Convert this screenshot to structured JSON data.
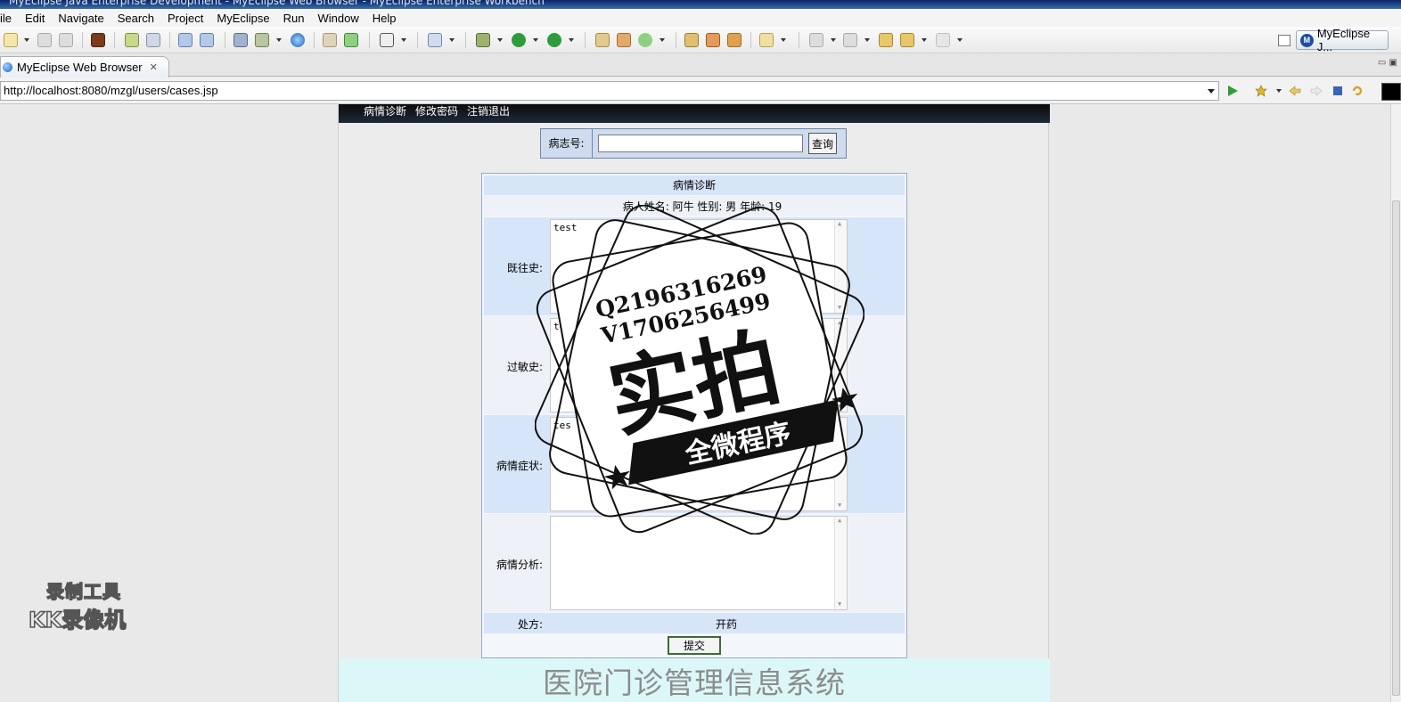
{
  "window": {
    "title": "MyEclipse Java Enterprise Development - MyEclipse Web Browser - MyEclipse Enterprise Workbench"
  },
  "menu": [
    "ile",
    "Edit",
    "Navigate",
    "Search",
    "Project",
    "MyEclipse",
    "Run",
    "Window",
    "Help"
  ],
  "toolbar": {
    "perspective_label": "MyEclipse J..."
  },
  "editor_tab": {
    "label": "MyEclipse Web Browser"
  },
  "browser": {
    "url": "http://localhost:8080/mzgl/users/cases.jsp"
  },
  "page": {
    "nav": [
      "病情诊断",
      "修改密码",
      "注销退出"
    ],
    "search": {
      "label": "病志号:",
      "value": "",
      "button": "查询"
    },
    "form": {
      "title": "病情诊断",
      "patient_info": "病人姓名: 阿牛 性别: 男 年龄: 19",
      "fields": [
        {
          "label": "既往史:",
          "value": "test"
        },
        {
          "label": "过敏史:",
          "value": "test"
        },
        {
          "label": "病情症状:",
          "value": "tes"
        },
        {
          "label": "病情分析:",
          "value": ""
        }
      ],
      "prescription_label": "处方:",
      "prescription_value": "开药",
      "submit": "提交"
    },
    "footer": "医院门诊管理信息系统"
  },
  "watermark": {
    "line1": "Q2196316269",
    "line2": "V1706256499",
    "big": "实拍",
    "banner": "全微程序"
  },
  "recorder_watermark": {
    "line1": "录制工具",
    "line2": "KK录像机"
  },
  "colors": {
    "form_header": "#d7e5f9",
    "nav_bg": "#0b0b0b",
    "footer_bg": "#dcf7f7",
    "footer_text": "#8c8c8c"
  }
}
